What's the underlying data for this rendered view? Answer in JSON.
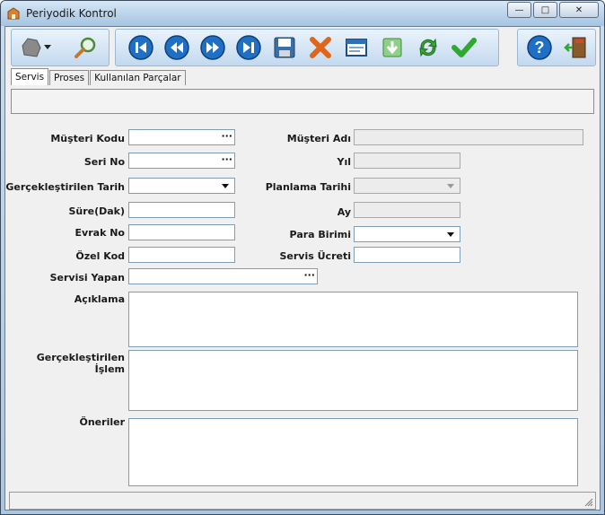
{
  "window": {
    "title": "Periyodik Kontrol",
    "buttons": {
      "minimize": "—",
      "maximize": "□",
      "close": "✕"
    }
  },
  "toolbar": {
    "groups": [
      {
        "icons": [
          "component-icon",
          "dropdown-arrow-icon",
          "search-icon"
        ]
      },
      {
        "icons": [
          "first-record-icon",
          "previous-record-icon",
          "next-record-icon",
          "last-record-icon",
          "save-icon",
          "delete-icon",
          "window-icon",
          "download-icon",
          "refresh-icon",
          "check-icon"
        ]
      },
      {
        "icons": [
          "help-icon",
          "exit-icon"
        ]
      }
    ]
  },
  "tabs": [
    "Servis",
    "Proses",
    "Kullanılan Parçalar"
  ],
  "form": {
    "musteri_kodu": {
      "label": "Müşteri Kodu",
      "value": ""
    },
    "musteri_adi": {
      "label": "Müşteri Adı",
      "value": ""
    },
    "seri_no": {
      "label": "Seri No",
      "value": ""
    },
    "yil": {
      "label": "Yıl",
      "value": ""
    },
    "gerceklestirilen_tarih": {
      "label": "Gerçekleştirilen Tarih",
      "value": ""
    },
    "planlama_tarihi": {
      "label": "Planlama Tarihi",
      "value": ""
    },
    "sure": {
      "label": "Süre(Dak)",
      "value": ""
    },
    "ay": {
      "label": "Ay",
      "value": ""
    },
    "evrak_no": {
      "label": "Evrak No",
      "value": ""
    },
    "para_birimi": {
      "label": "Para Birimi",
      "value": ""
    },
    "ozel_kod": {
      "label": "Özel Kod",
      "value": ""
    },
    "servis_ucreti": {
      "label": "Servis Ücreti",
      "value": ""
    },
    "servisi_yapan": {
      "label": "Servisi Yapan",
      "value": ""
    },
    "aciklama": {
      "label": "Açıklama",
      "value": ""
    },
    "gerceklestirilen_islem": {
      "label": "Gerçekleştirilen İşlem",
      "value": ""
    },
    "oneriler": {
      "label": "Öneriler",
      "value": ""
    },
    "lookup_glyph": "···"
  },
  "colors": {
    "accent": "#1f6fc5",
    "toolbar_bg": "#c3d9ef",
    "disabled_field": "#ececec"
  }
}
